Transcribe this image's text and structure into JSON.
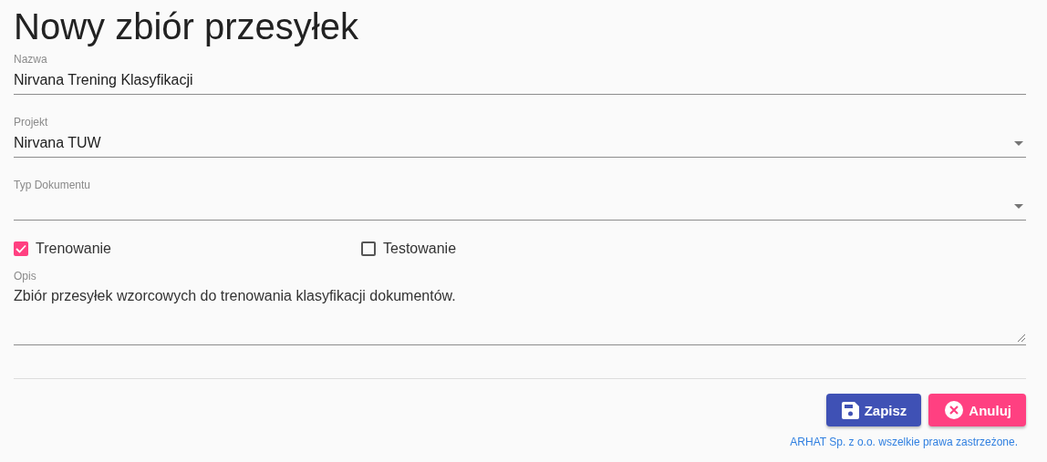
{
  "title": "Nowy zbiór przesyłek",
  "fields": [
    {
      "kind": "text",
      "label": "Nazwa",
      "value": "Nirvana Trening Klasyfikacji"
    },
    {
      "kind": "select",
      "label": "Projekt",
      "value": "Nirvana TUW"
    },
    {
      "kind": "select",
      "label": "Typ Dokumentu"
    }
  ],
  "checkboxes": [
    {
      "label": "Trenowanie",
      "checked": true
    },
    {
      "label": "Testowanie",
      "checked": false
    }
  ],
  "description": {
    "label": "Opis",
    "value": "Zbiór przesyłek wzorcowych do trenowania klasyfikacji dokumentów."
  },
  "buttons": [
    {
      "kind": "save",
      "label": "Zapisz"
    },
    {
      "kind": "cancel",
      "label": "Anuluj"
    }
  ],
  "footer": "ARHAT Sp. z o.o. wszelkie prawa zastrzeżone."
}
